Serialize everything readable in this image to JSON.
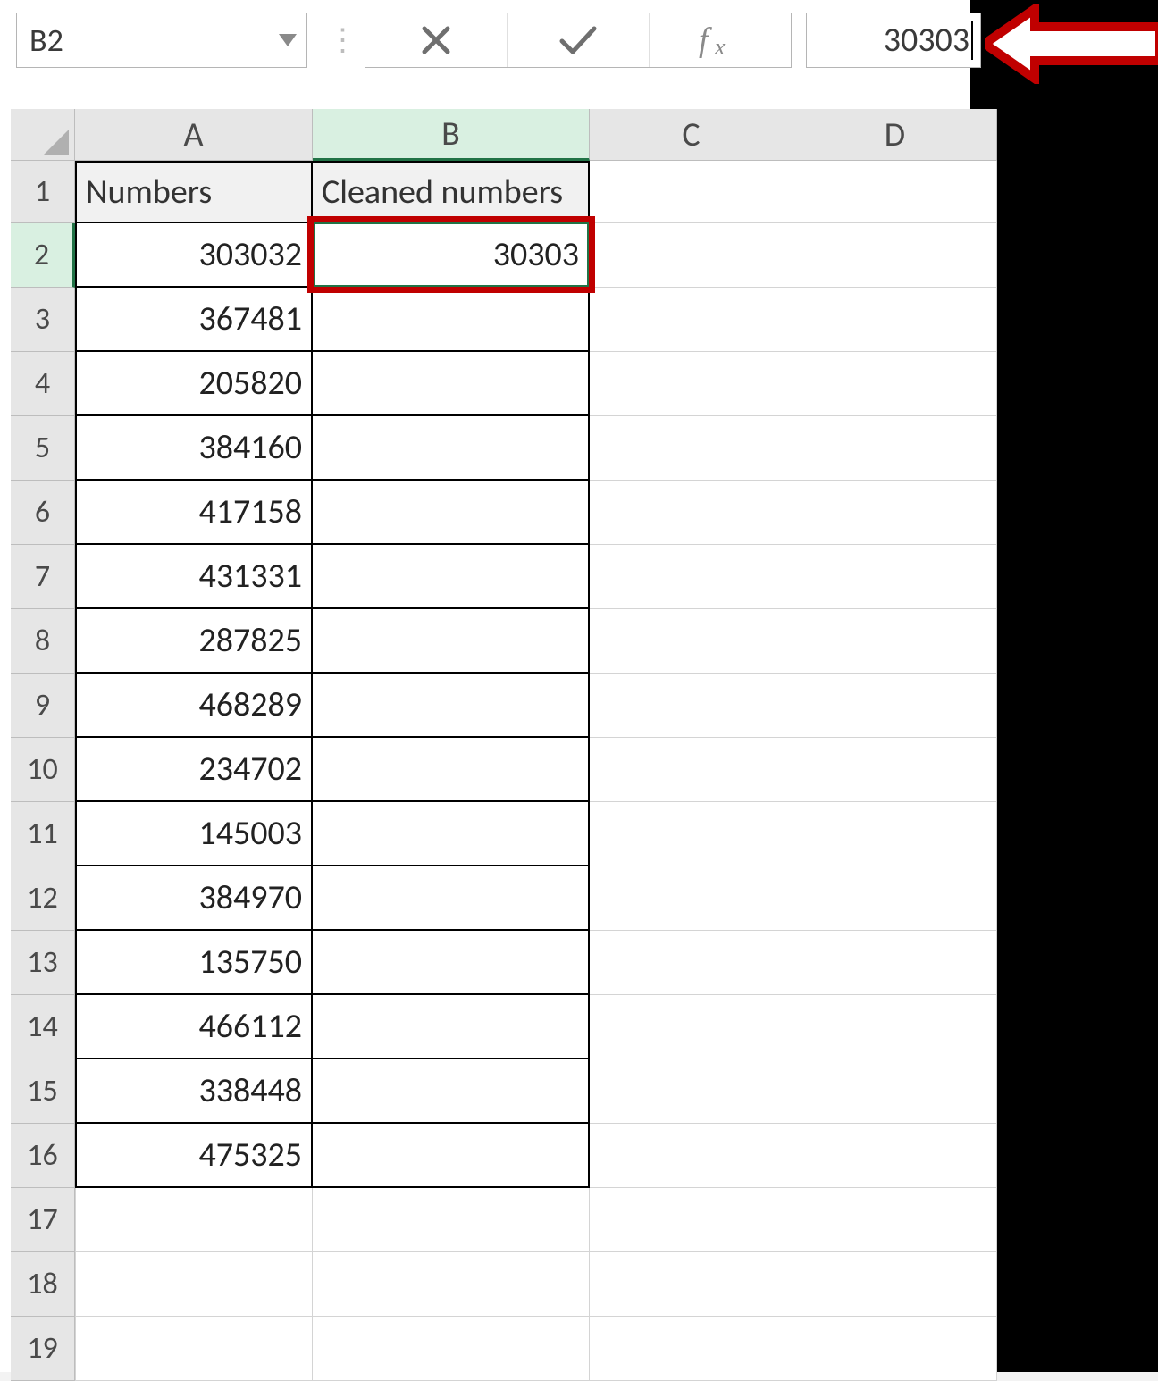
{
  "namebox": {
    "value": "B2"
  },
  "formula_bar": {
    "value": "30303"
  },
  "columns": [
    "A",
    "B",
    "C",
    "D"
  ],
  "active": {
    "col": "B",
    "row": 2
  },
  "headers": {
    "A": "Numbers",
    "B": "Cleaned numbers"
  },
  "rows": [
    {
      "n": 1
    },
    {
      "n": 2,
      "A": "303032",
      "B": "30303"
    },
    {
      "n": 3,
      "A": "367481",
      "B": ""
    },
    {
      "n": 4,
      "A": "205820",
      "B": ""
    },
    {
      "n": 5,
      "A": "384160",
      "B": ""
    },
    {
      "n": 6,
      "A": "417158",
      "B": ""
    },
    {
      "n": 7,
      "A": "431331",
      "B": ""
    },
    {
      "n": 8,
      "A": "287825",
      "B": ""
    },
    {
      "n": 9,
      "A": "468289",
      "B": ""
    },
    {
      "n": 10,
      "A": "234702",
      "B": ""
    },
    {
      "n": 11,
      "A": "145003",
      "B": ""
    },
    {
      "n": 12,
      "A": "384970",
      "B": ""
    },
    {
      "n": 13,
      "A": "135750",
      "B": ""
    },
    {
      "n": 14,
      "A": "466112",
      "B": ""
    },
    {
      "n": 15,
      "A": "338448",
      "B": ""
    },
    {
      "n": 16,
      "A": "475325",
      "B": ""
    },
    {
      "n": 17
    },
    {
      "n": 18
    },
    {
      "n": 19
    }
  ],
  "annotations": {
    "highlight_cell": "B2",
    "arrow_points_to": "formula_bar"
  }
}
